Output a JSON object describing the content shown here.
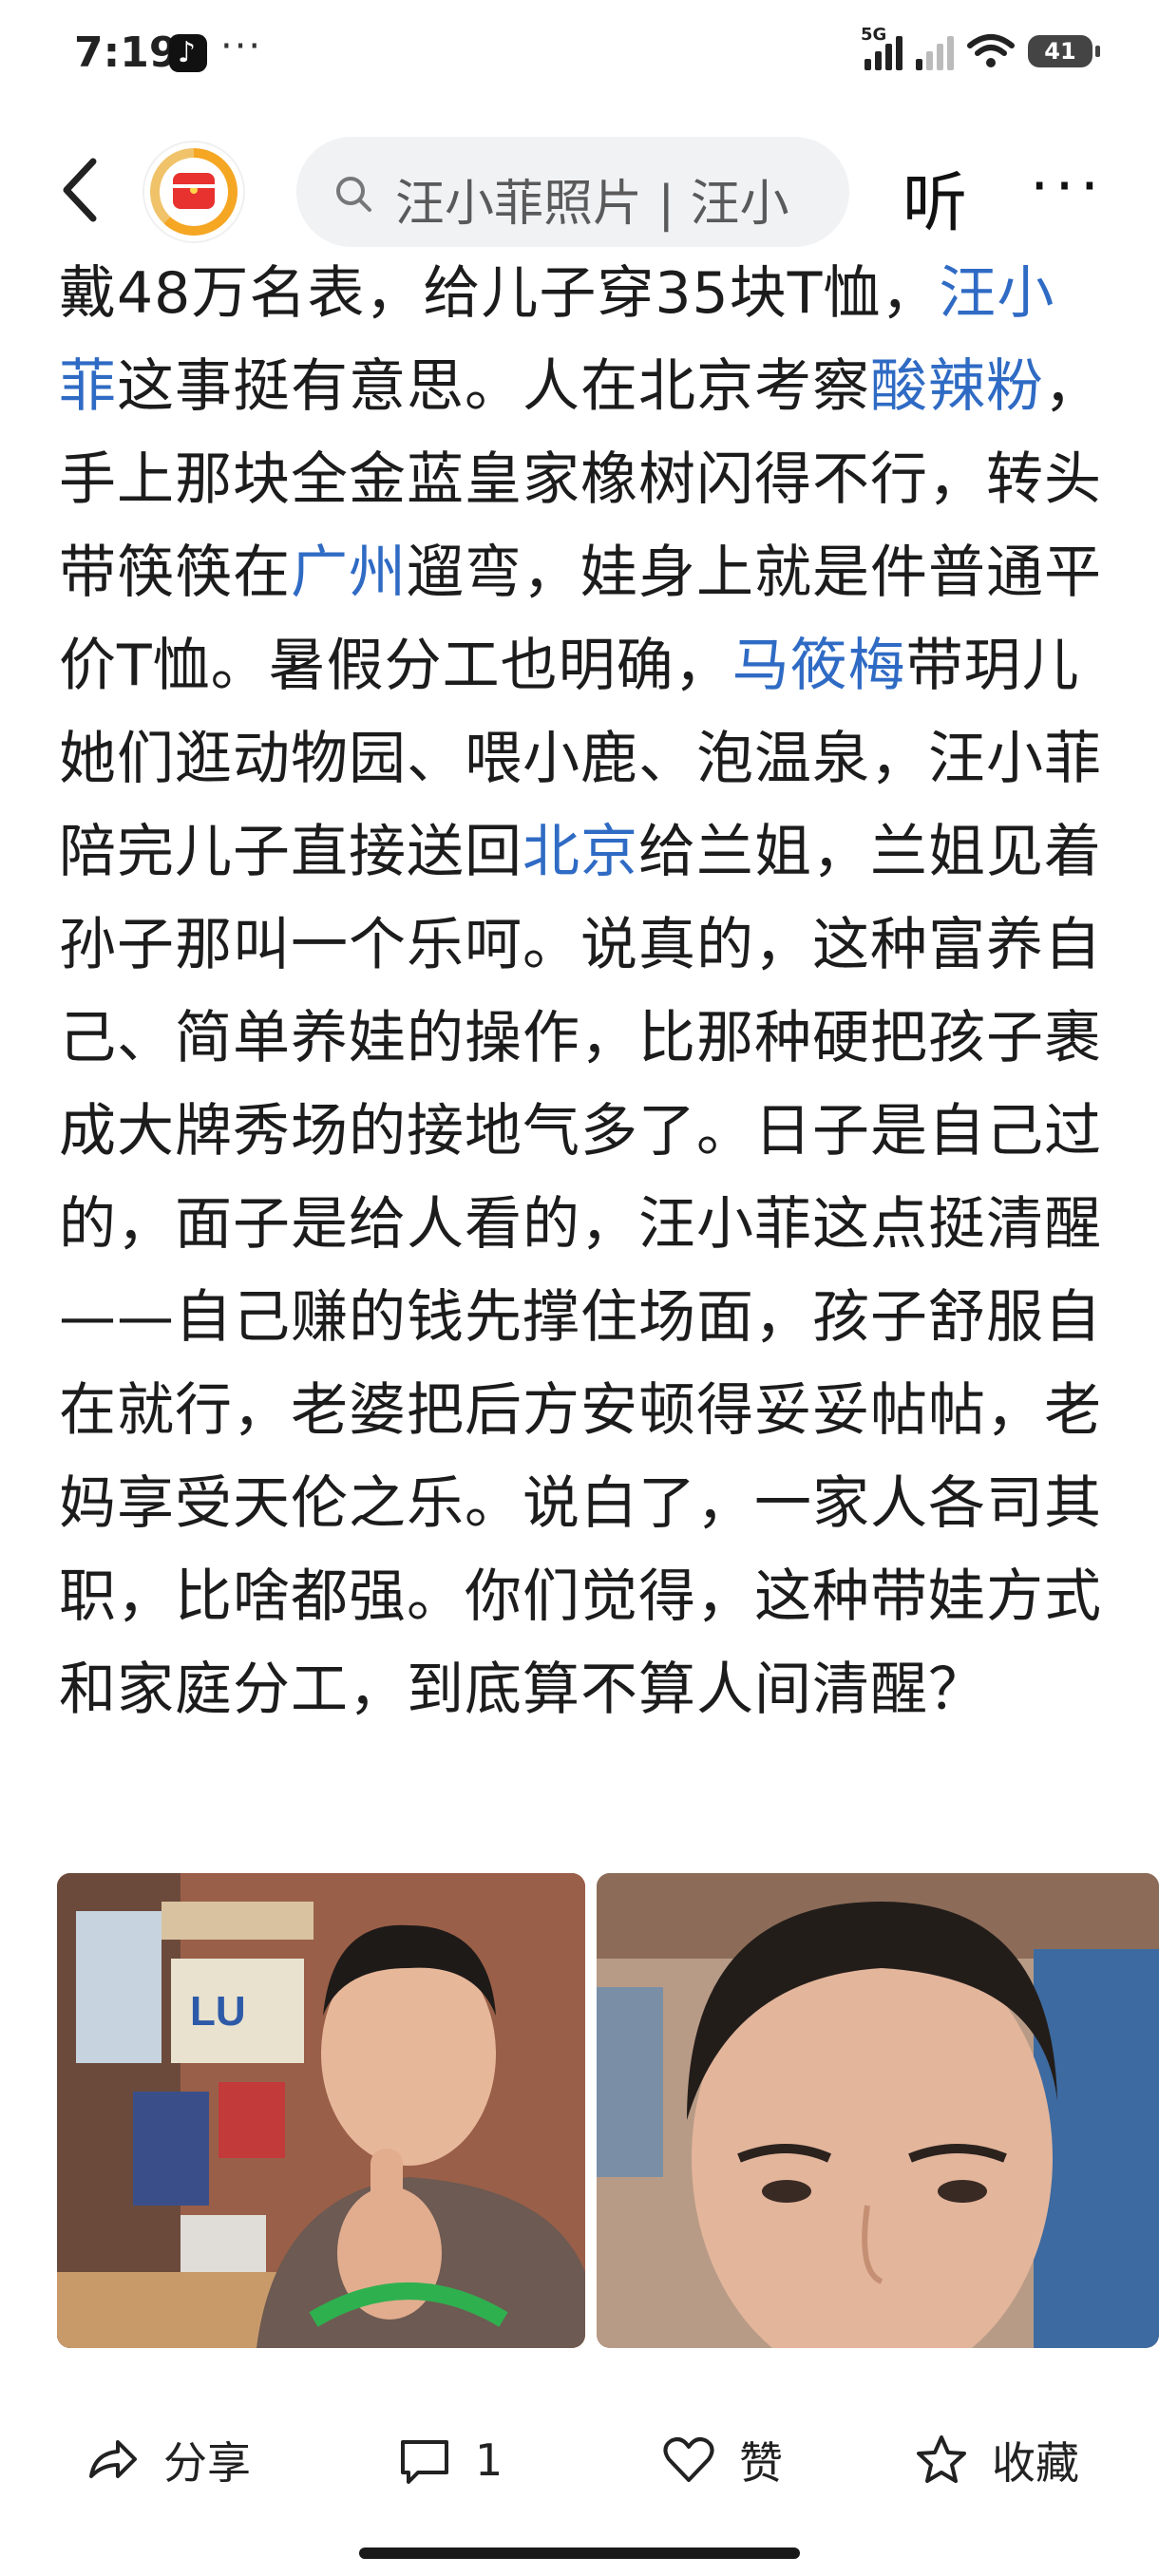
{
  "status": {
    "time": "7:19",
    "more": "···",
    "signal_label": "5G",
    "battery": "41"
  },
  "nav": {
    "search_text": "汪小菲照片 | 汪小",
    "listen_label": "听",
    "more_label": "···"
  },
  "article": {
    "segments": [
      {
        "text": "戴48万名表，给儿子穿35块T恤，",
        "link": false
      },
      {
        "text": "汪小菲",
        "link": true
      },
      {
        "text": "这事挺有意思。人在北京考察",
        "link": false
      },
      {
        "text": "酸辣粉",
        "link": true
      },
      {
        "text": "，手上那块全金蓝皇家橡树闪得不行，转头带筷筷在",
        "link": false
      },
      {
        "text": "广州",
        "link": true
      },
      {
        "text": "遛弯，娃身上就是件普通平价T恤。暑假分工也明确，",
        "link": false
      },
      {
        "text": "马筱梅",
        "link": true
      },
      {
        "text": "带玥儿她们逛动物园、喂小鹿、泡温泉，汪小菲陪完儿子直接送回",
        "link": false
      },
      {
        "text": "北京",
        "link": true
      },
      {
        "text": "给兰姐，兰姐见着孙子那叫一个乐呵。说真的，这种富养自己、简单养娃的操作，比那种硬把孩子裹成大牌秀场的接地气多了。日子是自己过的，面子是给人看的，汪小菲这点挺清醒——自己赚的钱先撑住场面，孩子舒服自在就行，老婆把后方安顿得妥妥帖帖，老妈享受天伦之乐。说白了，一家人各司其职，比啥都强。你们觉得，这种带娃方式和家庭分工，到底算不算人间清醒？",
        "link": false
      }
    ]
  },
  "photo_left_sign": "LU",
  "actions": {
    "share_label": "分享",
    "comment_count": "1",
    "like_label": "赞",
    "collect_label": "收藏"
  },
  "colors": {
    "link": "#2f6bc4",
    "logo_red": "#e8322f",
    "logo_orange": "#f5a623"
  }
}
